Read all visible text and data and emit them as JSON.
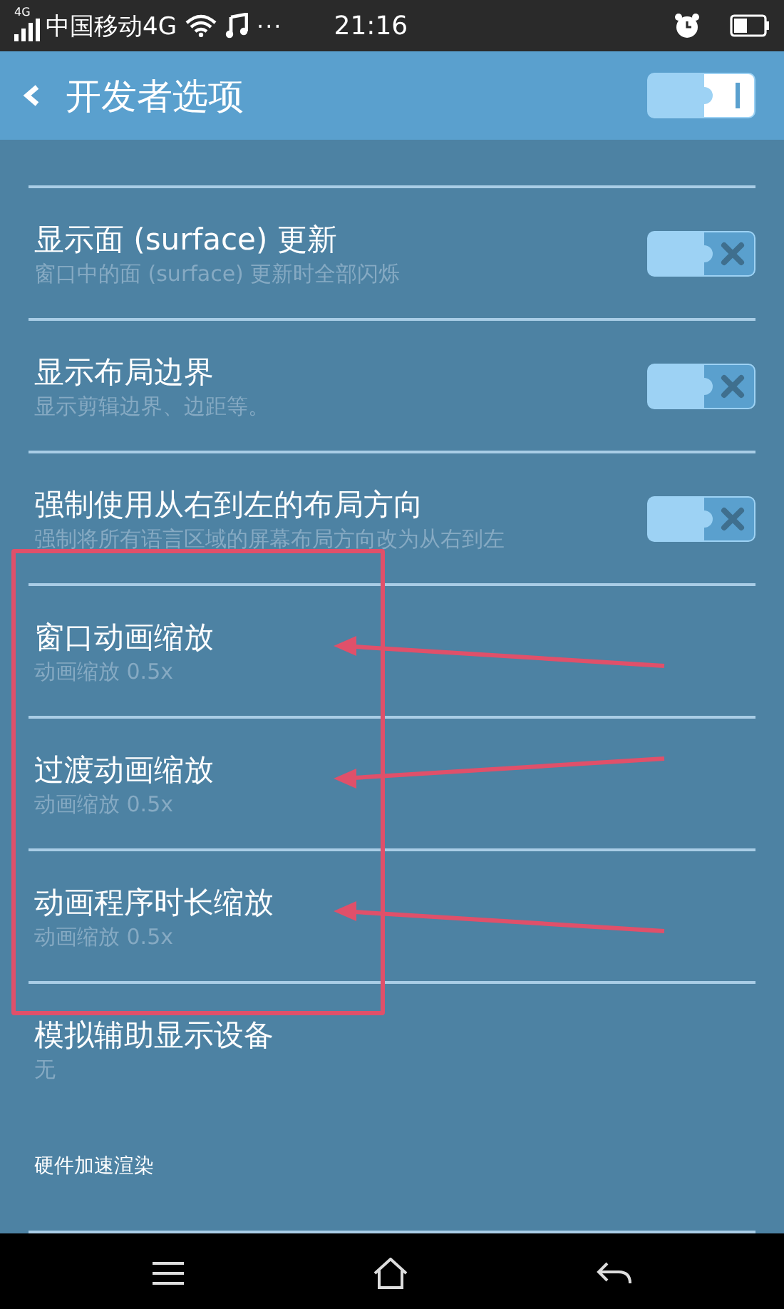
{
  "status_bar": {
    "network_badge": "4G",
    "carrier": "中国移动4G",
    "more": "···",
    "time": "21:16"
  },
  "header": {
    "title": "开发者选项",
    "toggle": {
      "on": true
    }
  },
  "settings": [
    {
      "kind": "toggle",
      "title": "显示面 (surface) 更新",
      "summary": "窗口中的面 (surface) 更新时全部闪烁",
      "on": false,
      "highlighted": false
    },
    {
      "kind": "toggle",
      "title": "显示布局边界",
      "summary": "显示剪辑边界、边距等。",
      "on": false,
      "highlighted": false
    },
    {
      "kind": "toggle",
      "title": "强制使用从右到左的布局方向",
      "summary": "强制将所有语言区域的屏幕布局方向改为从右到左",
      "on": false,
      "highlighted": false
    },
    {
      "kind": "value",
      "title": "窗口动画缩放",
      "summary": "动画缩放 0.5x",
      "highlighted": true
    },
    {
      "kind": "value",
      "title": "过渡动画缩放",
      "summary": "动画缩放 0.5x",
      "highlighted": true
    },
    {
      "kind": "value",
      "title": "动画程序时长缩放",
      "summary": "动画缩放 0.5x",
      "highlighted": true
    },
    {
      "kind": "value",
      "title": "模拟辅助显示设备",
      "summary": "无",
      "highlighted": false
    },
    {
      "kind": "category",
      "title": "硬件加速渲染"
    }
  ]
}
